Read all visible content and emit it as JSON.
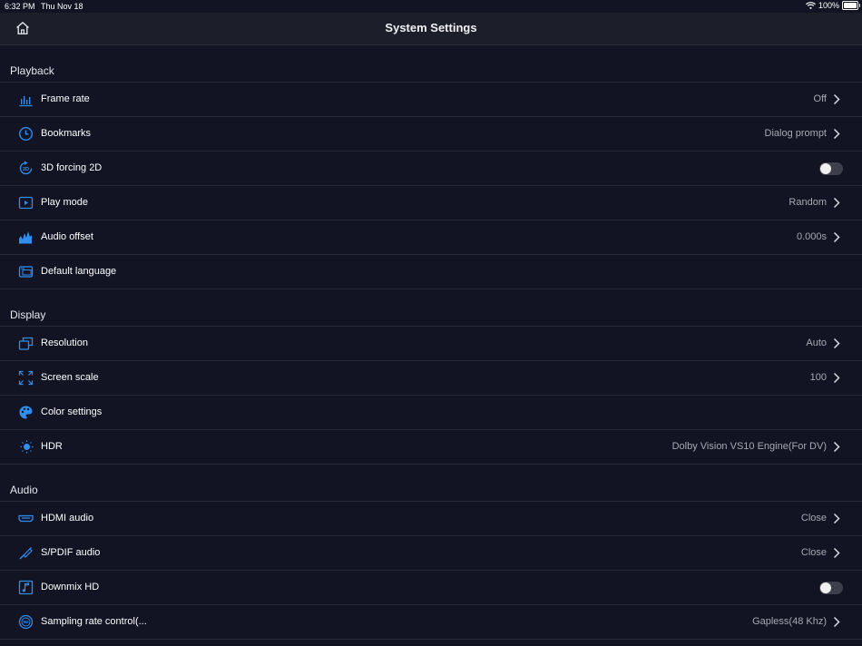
{
  "status_bar": {
    "time": "6:32 PM",
    "date": "Thu Nov 18",
    "battery": "100%"
  },
  "nav": {
    "title": "System Settings"
  },
  "colors": {
    "accent": "#2f8ef0",
    "background": "#121424",
    "bar": "#1c1e2a"
  },
  "sections": {
    "playback": {
      "title": "Playback",
      "frame_rate": {
        "label": "Frame rate",
        "value": "Off"
      },
      "bookmarks": {
        "label": "Bookmarks",
        "value": "Dialog prompt"
      },
      "forcing_2d": {
        "label": "3D forcing 2D",
        "on": false
      },
      "play_mode": {
        "label": "Play mode",
        "value": "Random"
      },
      "audio_offset": {
        "label": "Audio offset",
        "value": "0.000s"
      },
      "default_language": {
        "label": "Default language"
      }
    },
    "display": {
      "title": "Display",
      "resolution": {
        "label": "Resolution",
        "value": "Auto"
      },
      "screen_scale": {
        "label": "Screen scale",
        "value": "100"
      },
      "color_settings": {
        "label": "Color settings"
      },
      "hdr": {
        "label": "HDR",
        "value": "Dolby Vision VS10 Engine(For DV)"
      }
    },
    "audio": {
      "title": "Audio",
      "hdmi_audio": {
        "label": "HDMI audio",
        "value": "Close"
      },
      "spdif_audio": {
        "label": "S/PDIF audio",
        "value": "Close"
      },
      "downmix_hd": {
        "label": "Downmix HD",
        "on": false
      },
      "sampling_rate": {
        "label": "Sampling rate control(...",
        "value": "Gapless(48 Khz)"
      }
    }
  },
  "icons": [
    "home-icon",
    "bar-chart-icon",
    "clock-icon",
    "2d-rotate-icon",
    "play-icon",
    "audio-wave-icon",
    "language-icon",
    "resolution-icon",
    "expand-icon",
    "palette-icon",
    "hdr-icon",
    "hdmi-icon",
    "spdif-icon",
    "music-note-icon",
    "sampling-rate-icon",
    "chevron-right-icon",
    "wifi-icon",
    "battery-icon"
  ]
}
